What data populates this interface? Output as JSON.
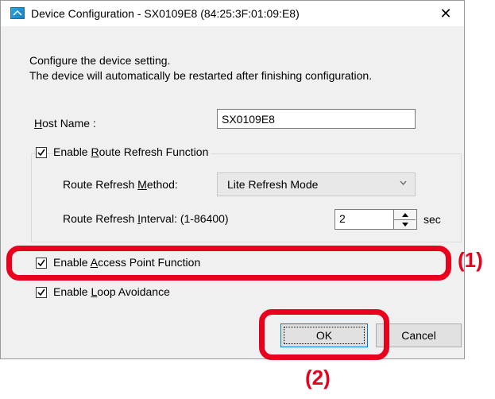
{
  "window": {
    "title": "Device Configuration - SX0109E8 (84:25:3F:01:09:E8)",
    "close_glyph": "✕"
  },
  "intro": {
    "line1": "Configure the device setting.",
    "line2": "The device will automatically be restarted after finishing configuration."
  },
  "host_name": {
    "label_first": "H",
    "label_rest": "ost Name :",
    "value": "SX0109E8"
  },
  "route_refresh": {
    "enable_label_pre": "Enable ",
    "enable_label_u": "R",
    "enable_label_post": "oute Refresh Function",
    "enabled": true,
    "method_label_pre": "Route Refresh ",
    "method_label_u": "M",
    "method_label_post": "ethod:",
    "method_value": "Lite Refresh Mode",
    "interval_label_pre": "Route Refresh ",
    "interval_label_u": "I",
    "interval_label_post": "nterval: (1-86400)",
    "interval_value": "2",
    "interval_unit": "sec"
  },
  "access_point": {
    "label_pre": "Enable ",
    "label_u": "A",
    "label_post": "ccess Point Function",
    "enabled": true
  },
  "loop_avoidance": {
    "label_pre": "Enable ",
    "label_u": "L",
    "label_post": "oop Avoidance",
    "enabled": true
  },
  "buttons": {
    "ok": "OK",
    "cancel": "Cancel"
  },
  "annotations": {
    "callout_1": "(1)",
    "callout_2": "(2)",
    "color": "#e8001c"
  },
  "icons": {
    "app": "device-config-app-icon",
    "close": "close-icon",
    "check": "checkmark-icon",
    "dropdown": "chevron-down-icon",
    "spin_up": "spin-up-icon",
    "spin_down": "spin-down-icon"
  }
}
